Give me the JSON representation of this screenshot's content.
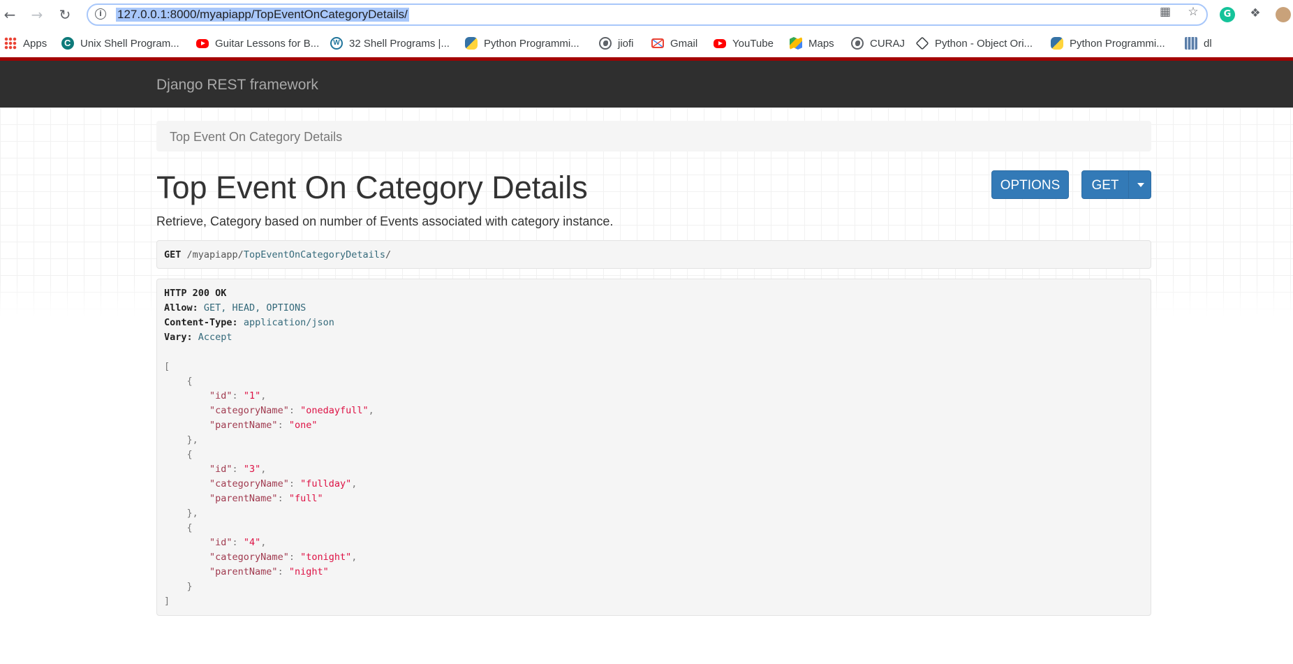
{
  "browser": {
    "url": "127.0.0.1:8000/myapiapp/TopEventOnCategoryDetails/",
    "bookmarks": [
      {
        "icon": "apps-grid-icon",
        "label": "Apps"
      },
      {
        "icon": "unix-site-icon",
        "label": "Unix Shell Program..."
      },
      {
        "icon": "youtube-icon",
        "label": "Guitar Lessons for B..."
      },
      {
        "icon": "wordpress-icon",
        "label": "32 Shell Programs |..."
      },
      {
        "icon": "python-icon",
        "label": "Python Programmi..."
      },
      {
        "icon": "globe-icon",
        "label": "jiofi"
      },
      {
        "icon": "gmail-icon",
        "label": "Gmail"
      },
      {
        "icon": "youtube-icon",
        "label": "YouTube"
      },
      {
        "icon": "maps-icon",
        "label": "Maps"
      },
      {
        "icon": "globe-icon",
        "label": "CURAJ"
      },
      {
        "icon": "diamond-icon",
        "label": "Python - Object Ori..."
      },
      {
        "icon": "python-icon",
        "label": "Python Programmi..."
      },
      {
        "icon": "dl-site-icon",
        "label": "dl"
      }
    ]
  },
  "page": {
    "brand": "Django REST framework",
    "breadcrumb": "Top Event On Category Details",
    "title": "Top Event On Category Details",
    "description": "Retrieve, Category based on number of Events associated with category instance.",
    "buttons": {
      "options": "OPTIONS",
      "get": "GET"
    },
    "request": {
      "method": "GET",
      "path_prefix": "/myapiapp/",
      "path_name": "TopEventOnCategoryDetails",
      "path_suffix": "/"
    },
    "response": {
      "status": "HTTP 200 OK",
      "headers": [
        {
          "name": "Allow:",
          "value": "GET, HEAD, OPTIONS"
        },
        {
          "name": "Content-Type:",
          "value": "application/json"
        },
        {
          "name": "Vary:",
          "value": "Accept"
        }
      ],
      "items": [
        {
          "id": "1",
          "categoryName": "onedayfull",
          "parentName": "one"
        },
        {
          "id": "3",
          "categoryName": "fullday",
          "parentName": "full"
        },
        {
          "id": "4",
          "categoryName": "tonight",
          "parentName": "night"
        }
      ]
    }
  }
}
